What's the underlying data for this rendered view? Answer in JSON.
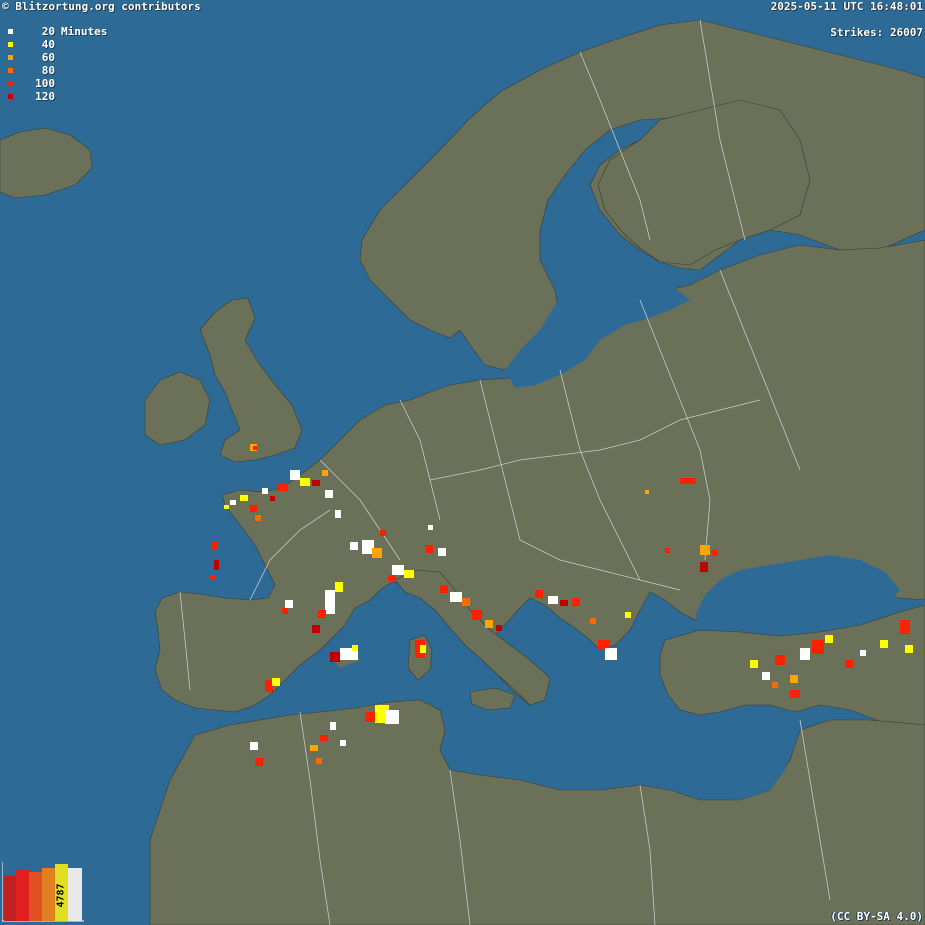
{
  "header": {
    "copyright": "© Blitzortung.org contributors",
    "timestamp": "2025-05-11 UTC 16:48:01",
    "strikes_label": "Strikes: 26007"
  },
  "legend": {
    "unit": "Minutes",
    "items": [
      {
        "label": "20",
        "color": "#ffffff"
      },
      {
        "label": "40",
        "color": "#ffff00"
      },
      {
        "label": "60",
        "color": "#ffa500"
      },
      {
        "label": "80",
        "color": "#ff6a00"
      },
      {
        "label": "100",
        "color": "#ff2000"
      },
      {
        "label": "120",
        "color": "#c00000"
      }
    ]
  },
  "histogram": {
    "current_count": "4787",
    "bar_colors": [
      "#c02020",
      "#e02020",
      "#e05020",
      "#e08020",
      "#e0e020",
      "#e8e8e8"
    ]
  },
  "footer": {
    "license": "(CC BY-SA 4.0)"
  },
  "colors": {
    "sea": "#2e6a96",
    "land": "#6b7058",
    "border": "#c8c8c8",
    "text_shadow": "#1e3d55"
  }
}
